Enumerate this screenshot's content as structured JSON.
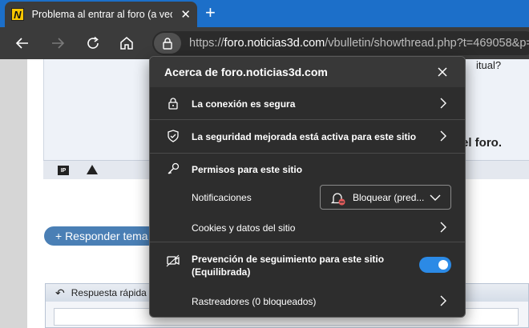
{
  "browser": {
    "tab": {
      "favicon_letter": "N",
      "title": "Problema al entrar al foro (a veces",
      "close_glyph": "✕"
    },
    "new_tab_glyph": "+",
    "address": {
      "scheme": "https://",
      "host": "foro.noticias3d.com",
      "path": "/vbulletin/showthread.php?t=469058&p="
    }
  },
  "page": {
    "fragment_top": "itual?",
    "fragment_mid": "el foro.",
    "ip_badge": "IP",
    "reply_button": "+ Responder tema",
    "quick_reply": "Respuesta rápida"
  },
  "site_info": {
    "title": "Acerca de foro.noticias3d.com",
    "connection": "La conexión es segura",
    "enhanced_security": "La seguridad mejorada está activa para este sitio",
    "permissions_header": "Permisos para este sitio",
    "notifications_label": "Notificaciones",
    "notifications_value": "Bloquear (pred...",
    "cookies": "Cookies y datos del sitio",
    "tracking_label_line1": "Prevención de seguimiento para este sitio",
    "tracking_label_line2": "(Equilibrada)",
    "tracking_enabled": true,
    "trackers": "Rastreadores (0 bloqueados)",
    "accent_color": "#2b8ae6"
  }
}
